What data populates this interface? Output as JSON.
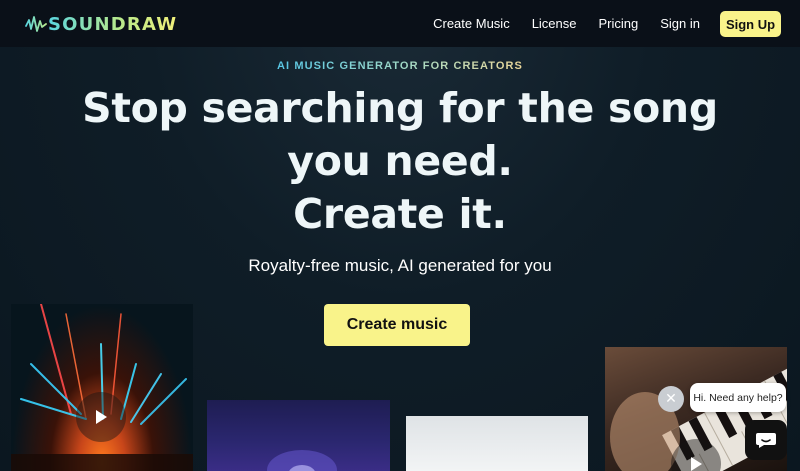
{
  "brand": {
    "name": "SOUNDRAW"
  },
  "nav": {
    "items": [
      {
        "label": "Create Music"
      },
      {
        "label": "License"
      },
      {
        "label": "Pricing"
      },
      {
        "label": "Sign in"
      }
    ],
    "signup_label": "Sign Up"
  },
  "hero": {
    "eyebrow": "AI MUSIC GENERATOR FOR CREATORS",
    "headline_line1": "Stop searching for the song you need.",
    "headline_line2": "Create it.",
    "subhead": "Royalty-free music, AI generated for you",
    "cta_label": "Create music"
  },
  "chat": {
    "prompt": "Hi. Need any help?",
    "close_glyph": "✕"
  },
  "colors": {
    "accent_yellow": "#f9f38a",
    "background": "#0f1d27",
    "navbar": "#0a1018"
  }
}
